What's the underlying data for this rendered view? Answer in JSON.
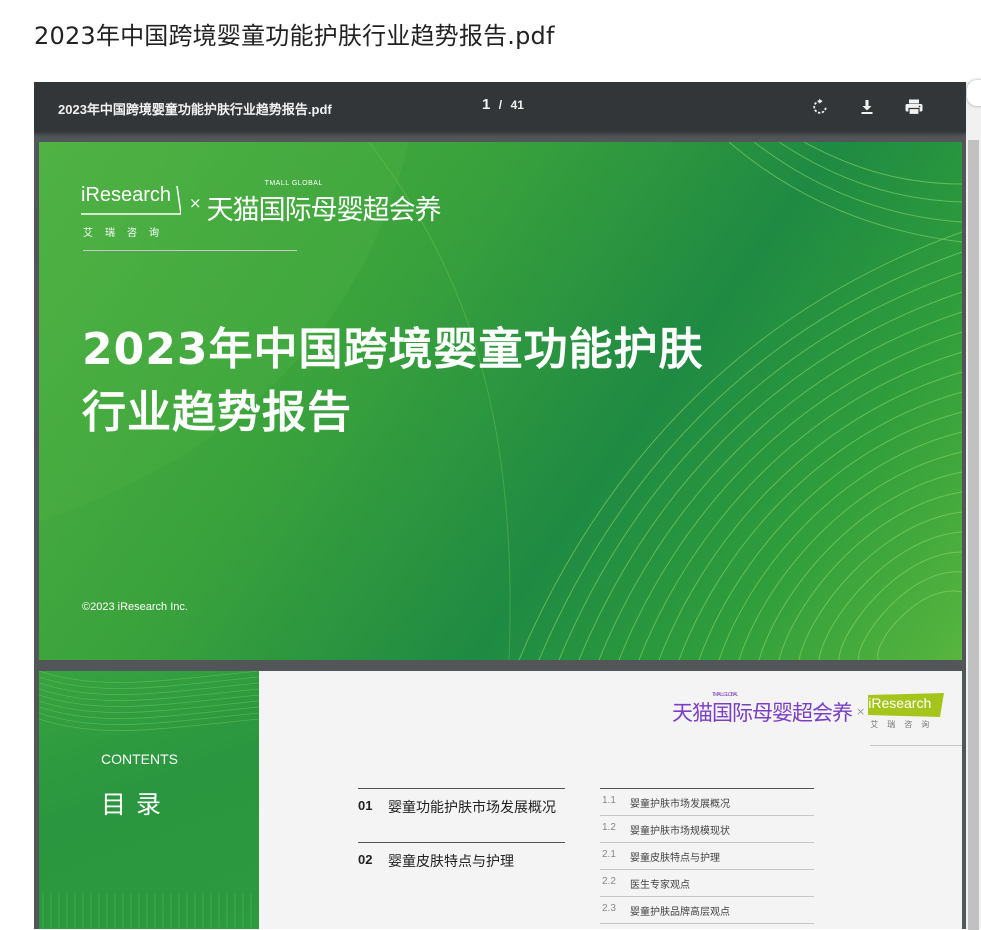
{
  "page_title": "2023年中国跨境婴童功能护肤行业趋势报告.pdf",
  "toolbar": {
    "file_name": "2023年中国跨境婴童功能护肤行业趋势报告.pdf",
    "current_page": "1",
    "separator": "/",
    "total_pages": "41",
    "icons": [
      "rotate-icon",
      "download-icon",
      "print-icon"
    ]
  },
  "page1": {
    "logo_iresearch": "iResearch",
    "logo_iresearch_cn": "艾瑞咨询",
    "logo_times": "×",
    "logo_tmall": "天猫国际母婴超会养",
    "logo_tmall_global": "TMALL GLOBAL",
    "title_line1": "2023年中国跨境婴童功能护肤",
    "title_line2": "行业趋势报告",
    "copyright": "©2023 iResearch Inc."
  },
  "page2": {
    "logo_tmall": "天猫国际母婴超会养",
    "logo_tmall_global": "TMALL GLOBAL",
    "logo_times": "×",
    "logo_iresearch": "iResearch",
    "logo_iresearch_cn": "艾瑞咨询",
    "contents_en": "CONTENTS",
    "contents_cn": "目录",
    "sections": [
      {
        "num": "01",
        "label": "婴童功能护肤市场发展概况"
      },
      {
        "num": "02",
        "label": "婴童皮肤特点与护理"
      }
    ],
    "subsections": [
      {
        "num": "1.1",
        "label": "婴童护肤市场发展概况"
      },
      {
        "num": "1.2",
        "label": "婴童护肤市场规模现状"
      },
      {
        "num": "2.1",
        "label": "婴童皮肤特点与护理"
      },
      {
        "num": "2.2",
        "label": "医生专家观点"
      },
      {
        "num": "2.3",
        "label": "婴童护肤品牌高层观点"
      }
    ]
  },
  "colors": {
    "toolbar_bg": "#323639",
    "viewer_bg": "#525659",
    "cover_green": "#2f9d3c",
    "tmall_purple": "#7a3fc6",
    "iresearch_lime": "#a6c51c"
  }
}
